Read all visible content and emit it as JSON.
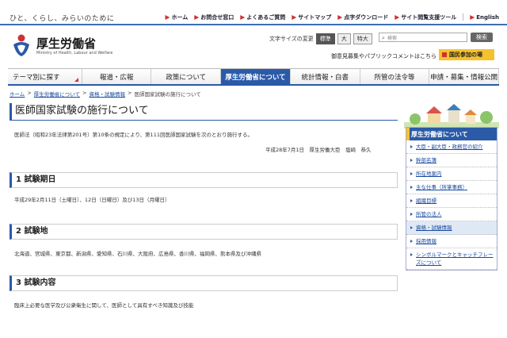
{
  "header": {
    "tagline": "ひと、くらし、みらいのために",
    "util_links": [
      "ホーム",
      "お問合せ窓口",
      "よくあるご質問",
      "サイトマップ",
      "点字ダウンロード",
      "サイト閲覧支援ツール",
      "English"
    ],
    "logo_title": "厚生労働省",
    "logo_sub": "Ministry of Health, Labour and Welfare",
    "font_size_label": "文字サイズの変更",
    "font_sizes": [
      "標準",
      "大",
      "特大"
    ],
    "search_placeholder": "検索",
    "search_button": "検索",
    "opinion_text": "御意見募集やパブリックコメントはこちら",
    "participate_label": "国民参加の場"
  },
  "nav": {
    "items": [
      "テーマ別に探す",
      "報道・広報",
      "政策について",
      "厚生労働省について",
      "統計情報・白書",
      "所管の法令等",
      "申請・募集・情報公開"
    ]
  },
  "breadcrumb": [
    "ホーム",
    "厚生労働省について",
    "資格・試験情報",
    "医師国家試験の施行について"
  ],
  "content": {
    "title": "医師国家試験の施行について",
    "intro": "医師法（昭和23年法律第201号）第10条の規定により、第111回医師国家試験を次のとおり施行する。",
    "signature": "平成28年7月1日　厚生労働大臣　塩崎　恭久",
    "sections": [
      {
        "heading": "1 試験期日",
        "body": "平成29年2月11日（土曜日）、12日（日曜日）及び13日（月曜日）"
      },
      {
        "heading": "2 試験地",
        "body": "北海道、宮城県、東京都、新潟県、愛知県、石川県、大阪府、広島県、香川県、福岡県、熊本県及び沖縄県"
      },
      {
        "heading": "3 試験内容",
        "body": "臨床上必要な医学及び公衆衛生に関して、医師として具有すべき知識及び技能"
      }
    ]
  },
  "sidebar": {
    "title": "厚生労働省について",
    "items": [
      "大臣・副大臣・政務官の紹介",
      "幹部名簿",
      "所在地案内",
      "主な仕事（所掌事務）",
      "組織目標",
      "所管の法人",
      "資格・試験情報",
      "採用情報",
      "シンボルマークとキャッチフレーズについて"
    ]
  },
  "colors": {
    "accent": "#2a5aa8",
    "highlight": "#f5c22e",
    "brand_red": "#cc3333"
  }
}
